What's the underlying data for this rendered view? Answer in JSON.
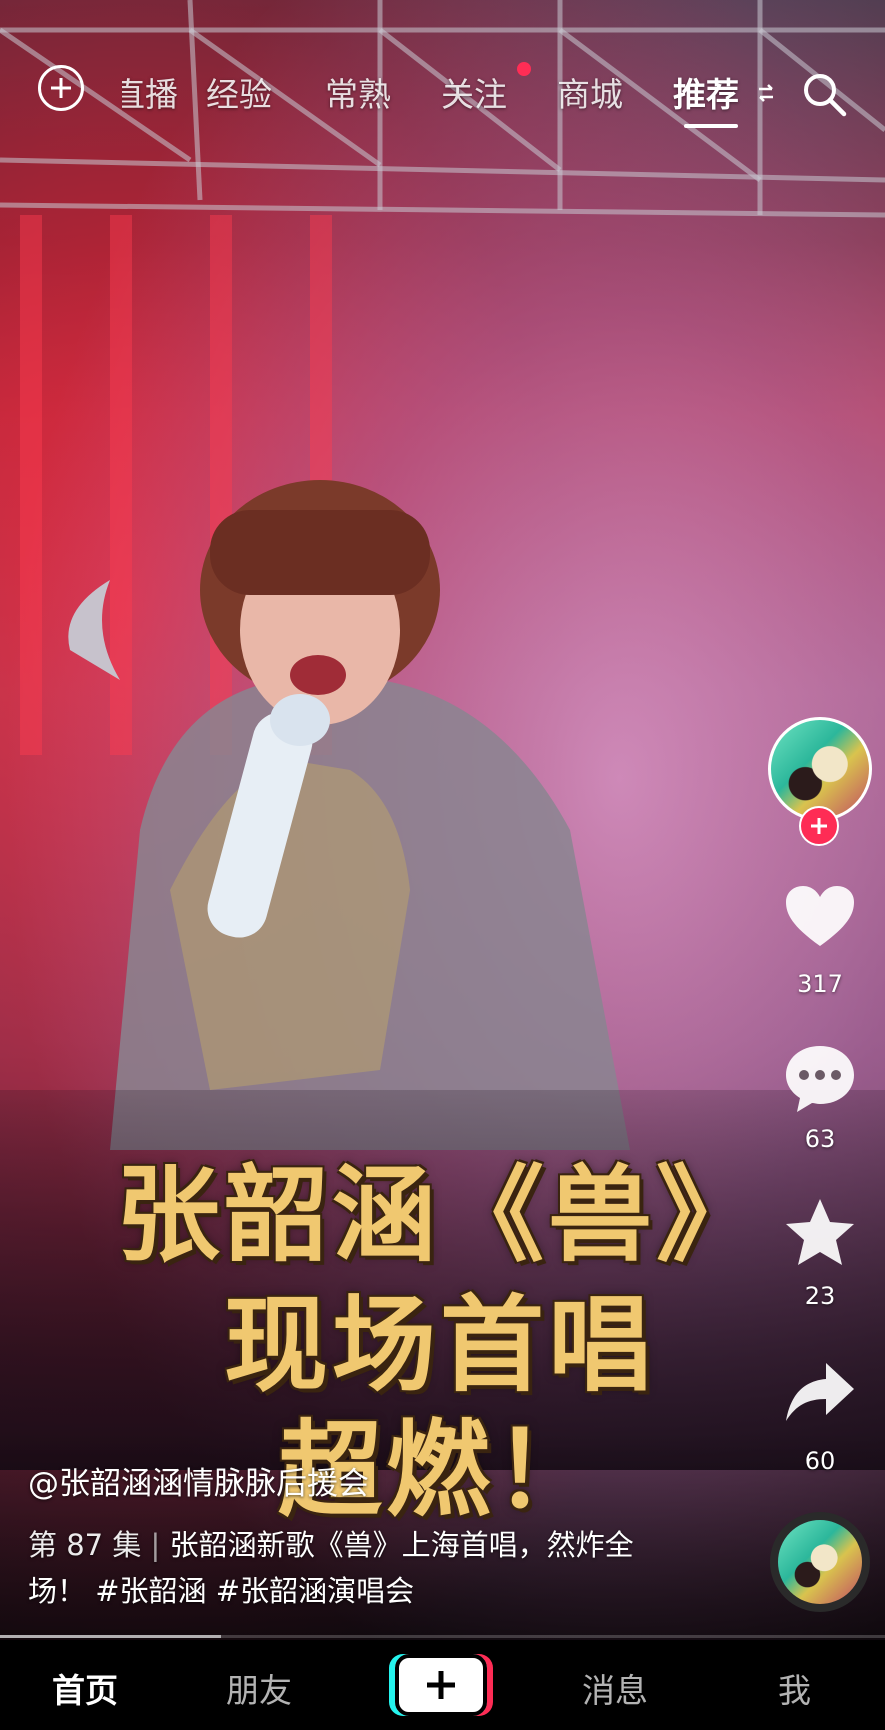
{
  "top_nav": {
    "tabs": [
      {
        "label": "直播"
      },
      {
        "label": "经验"
      },
      {
        "label": "常熟"
      },
      {
        "label": "关注"
      },
      {
        "label": "商城"
      },
      {
        "label": "推荐"
      }
    ],
    "active_tab": "推荐",
    "notification_dot_on": "关注"
  },
  "video": {
    "overlay_title_line1": "张韶涵《兽》",
    "overlay_title_line2": "现场首唱",
    "overlay_title_line3": "超燃！"
  },
  "actions": {
    "likes": "317",
    "comments": "63",
    "favorites": "23",
    "shares": "60"
  },
  "post": {
    "author": "@张韶涵涵情脉脉后援会",
    "episode": "第 87 集",
    "description": "张韶涵新歌《兽》上海首唱，然炸全场！",
    "hashtags": [
      "#张韶涵",
      "#张韶涵演唱会"
    ]
  },
  "playback": {
    "progress": 0.25
  },
  "bottom_nav": {
    "items": [
      {
        "label": "首页"
      },
      {
        "label": "朋友"
      },
      {
        "label": "消息"
      },
      {
        "label": "我"
      }
    ],
    "active": "首页"
  },
  "colors": {
    "accent": "#fe2c55",
    "caption_gold": "#f0c870",
    "cyan": "#25f4ee"
  }
}
